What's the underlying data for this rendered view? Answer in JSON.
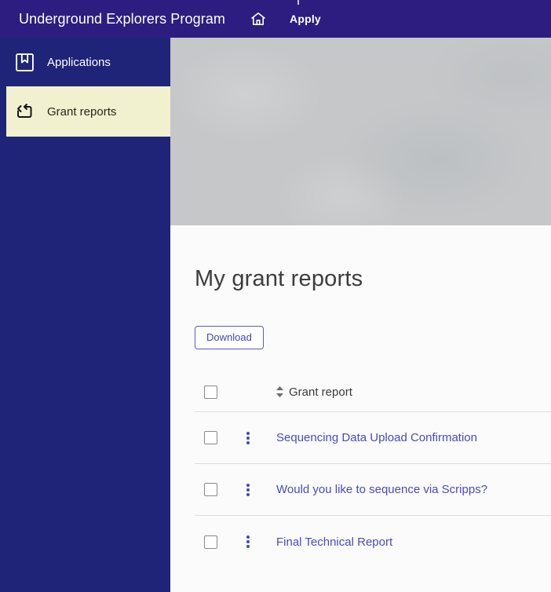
{
  "topbar": {
    "title": "Underground Explorers Program",
    "home_icon": "home-icon",
    "apply_label": "Apply"
  },
  "sidebar": {
    "items": [
      {
        "label": "Applications",
        "icon": "bookmark-icon",
        "active": false
      },
      {
        "label": "Grant reports",
        "icon": "repeat-icon",
        "active": true
      }
    ]
  },
  "main": {
    "heading": "My grant reports",
    "download_label": "Download",
    "table": {
      "column_header": "Grant report",
      "sort_icon": "sort-arrows-icon",
      "row_menu_icon": "kebab-menu-icon",
      "rows": [
        {
          "title": "Sequencing Data Upload Confirmation",
          "checked": false
        },
        {
          "title": "Would you like to sequence via Scripps?",
          "checked": false
        },
        {
          "title": "Final Technical Report",
          "checked": false
        }
      ]
    }
  },
  "colors": {
    "topbar_bg": "#2e1d80",
    "sidebar_bg": "#1f2478",
    "active_item_bg": "#f1f1cf",
    "accent_link": "#4a49c7",
    "banner_bg": "#c5c7c9"
  }
}
